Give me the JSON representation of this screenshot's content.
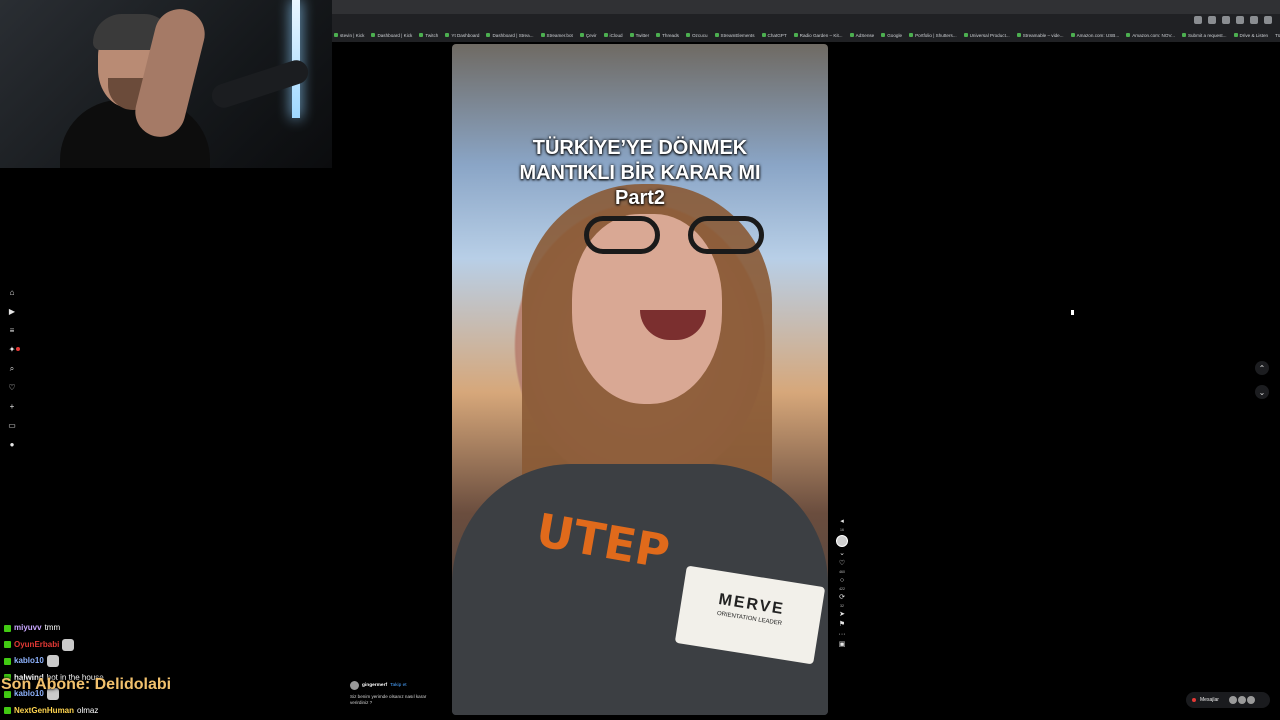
{
  "bookmarks": [
    "stevin | Kick",
    "Dashboard | Kick",
    "Twitch",
    "Yt Dashboard",
    "Dashboard | Strea...",
    "Streamer.bot",
    "Çevir",
    "iCloud",
    "Twitter",
    "Threads",
    "Ozcucu",
    "StreamElements",
    "ChatGPT",
    "Radio Garden – Kit...",
    "AdSense",
    "Google",
    "Portfolio | Shutters...",
    "Universal Product...",
    "Streamable – vide...",
    "Amazon.com: USB...",
    "Amazon.com: NOV...",
    "Submit a request...",
    "Drive & Listen"
  ],
  "bookmarks_right": "Tüm Yer İşaretleri",
  "video": {
    "caption_lines": [
      "TÜRKİYE’YE DÖNMEK",
      "MANTIKLI BİR KARAR MI",
      "Part2"
    ],
    "name_tag": "MERVE",
    "name_tag_sub": "ORIENTATION LEADER",
    "shirt_logo": "UTEP"
  },
  "post": {
    "username": "gingermerf",
    "follow_label": "Takip et",
    "description": "Siz benim yerimde olsanız nasıl karar verirdiniz ?"
  },
  "actions": {
    "top_count": "16",
    "like_count": "460",
    "comment_count": "422",
    "share_count": "32"
  },
  "messages": {
    "label": "Mesajlar"
  },
  "chat": [
    {
      "user": "miyuvv",
      "text": "tmm",
      "color": "#c9a7ff",
      "emote": false
    },
    {
      "user": "OyunErbabi",
      "text": "",
      "color": "#e53935",
      "emote": true
    },
    {
      "user": "kablo10",
      "text": "",
      "color": "#8fb4ff",
      "emote": true
    },
    {
      "user": "halwind",
      "text": "bot in the house",
      "color": "#ffffff",
      "emote": false
    },
    {
      "user": "kablo10",
      "text": "",
      "color": "#8fb4ff",
      "emote": true
    },
    {
      "user": "NextGenHuman",
      "text": "olmaz",
      "color": "#ffd54f",
      "emote": false
    }
  ],
  "alert": {
    "text": "Son Abone: Delidolabi"
  }
}
